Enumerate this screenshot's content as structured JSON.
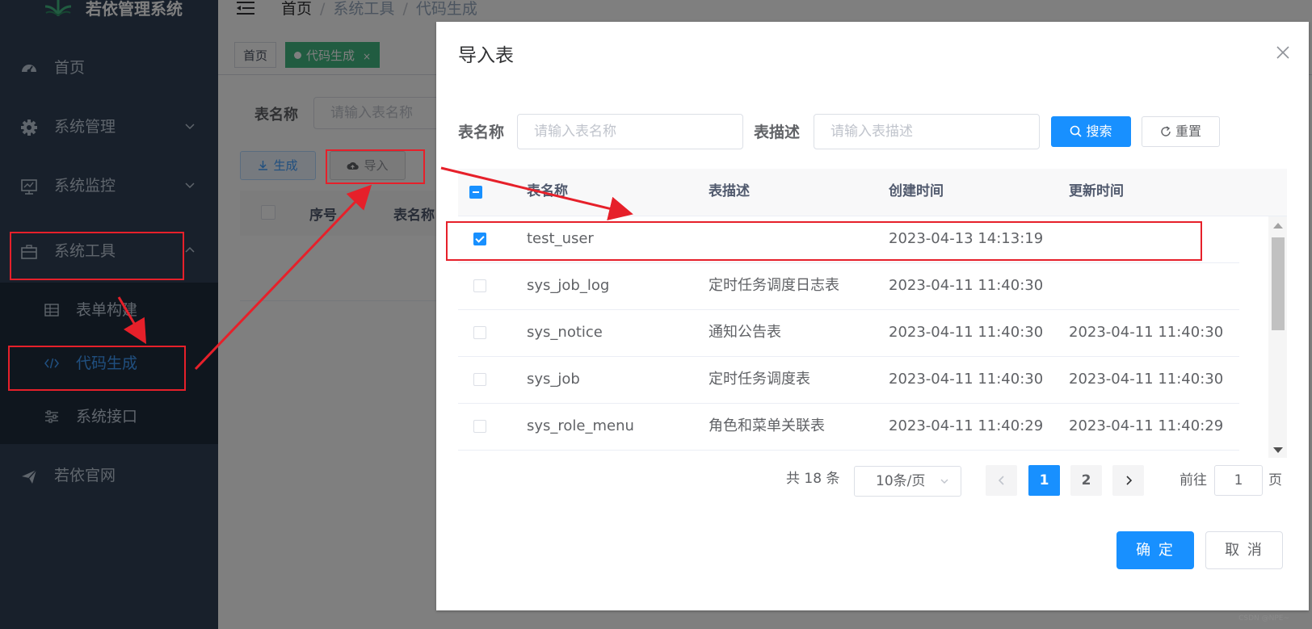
{
  "app": {
    "title": "若依管理系统"
  },
  "sidebar": {
    "items": [
      {
        "label": "首页",
        "icon": "dashboard-icon"
      },
      {
        "label": "系统管理",
        "icon": "gear-icon"
      },
      {
        "label": "系统监控",
        "icon": "monitor-icon"
      },
      {
        "label": "系统工具",
        "icon": "toolbox-icon"
      },
      {
        "label": "若依官网",
        "icon": "paper-plane-icon"
      }
    ],
    "tools_submenu": [
      {
        "label": "表单构建",
        "icon": "table-icon"
      },
      {
        "label": "代码生成",
        "icon": "code-icon",
        "active": true
      },
      {
        "label": "系统接口",
        "icon": "sliders-icon"
      }
    ]
  },
  "navbar": {
    "breadcrumb": [
      "首页",
      "系统工具",
      "代码生成"
    ],
    "breadcrumb_separator": "/"
  },
  "tags_view": {
    "tags": [
      {
        "label": "首页"
      },
      {
        "label": "代码生成",
        "close": "×",
        "active": true
      }
    ]
  },
  "background_page": {
    "table_name_label": "表名称",
    "table_name_placeholder": "请输入表名称",
    "generate_label": "生成",
    "import_label": "导入",
    "table_headers": [
      "序号",
      "表名称"
    ]
  },
  "dialog": {
    "title": "导入表",
    "filters": {
      "table_name_label": "表名称",
      "table_name_placeholder": "请输入表名称",
      "table_desc_label": "表描述",
      "table_desc_placeholder": "请输入表描述",
      "search_label": "搜索",
      "reset_label": "重置"
    },
    "table": {
      "headers": [
        "表名称",
        "表描述",
        "创建时间",
        "更新时间"
      ],
      "rows": [
        {
          "name": "test_user",
          "desc": "",
          "created": "2023-04-13 14:13:19",
          "updated": "",
          "checked": true
        },
        {
          "name": "sys_job_log",
          "desc": "定时任务调度日志表",
          "created": "2023-04-11 11:40:30",
          "updated": "",
          "checked": false
        },
        {
          "name": "sys_notice",
          "desc": "通知公告表",
          "created": "2023-04-11 11:40:30",
          "updated": "2023-04-11 11:40:30",
          "checked": false
        },
        {
          "name": "sys_job",
          "desc": "定时任务调度表",
          "created": "2023-04-11 11:40:30",
          "updated": "2023-04-11 11:40:30",
          "checked": false
        },
        {
          "name": "sys_role_menu",
          "desc": "角色和菜单关联表",
          "created": "2023-04-11 11:40:29",
          "updated": "2023-04-11 11:40:29",
          "checked": false
        }
      ]
    },
    "pagination": {
      "total": "共 18 条",
      "page_size": "10条/页",
      "pages": [
        "1",
        "2"
      ],
      "current_page": "1",
      "goto_label": "前往",
      "goto_value": "1",
      "goto_unit": "页"
    },
    "confirm_label": "确 定",
    "cancel_label": "取 消"
  },
  "watermark": "CSDN @NPE~",
  "colors": {
    "primary": "#1890ff",
    "sidebar_bg": "#304156",
    "submenu_bg": "#1f2d3d",
    "annotation_red": "#e6202a"
  }
}
